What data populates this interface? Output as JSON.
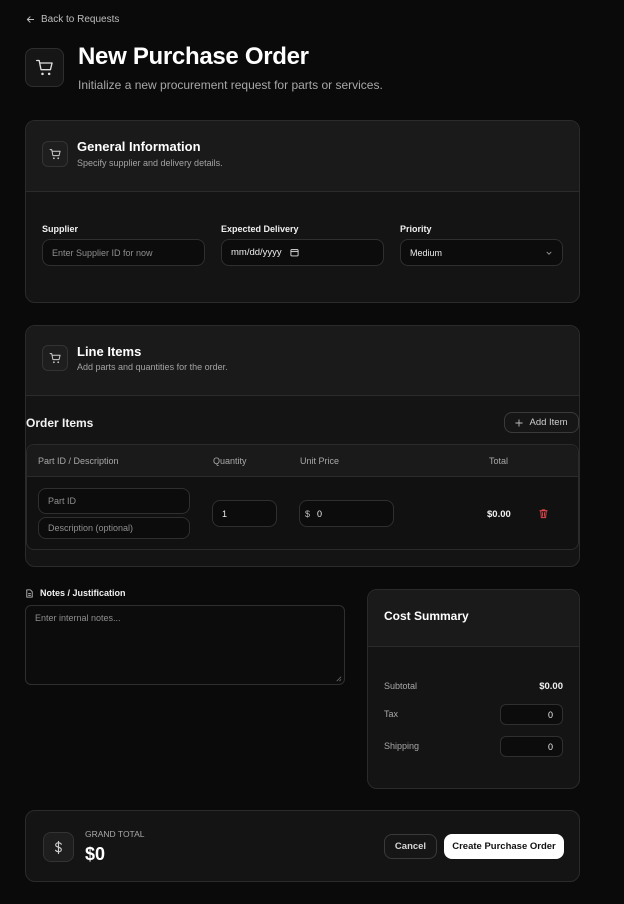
{
  "nav": {
    "back_label": "Back to Requests"
  },
  "header": {
    "title": "New Purchase Order",
    "subtitle": "Initialize a new procurement request for parts or services."
  },
  "general": {
    "title": "General Information",
    "subtitle": "Specify supplier and delivery details.",
    "supplier_label": "Supplier",
    "supplier_placeholder": "Enter Supplier ID for now",
    "delivery_label": "Expected Delivery",
    "delivery_value": "mm/dd/yyyy",
    "priority_label": "Priority",
    "priority_value": "Medium"
  },
  "line_items": {
    "title": "Line Items",
    "subtitle": "Add parts and quantities for the order.",
    "order_items_label": "Order Items",
    "add_item_label": "Add Item",
    "columns": [
      "Part ID / Description",
      "Quantity",
      "Unit Price",
      "Total"
    ],
    "rows": [
      {
        "part_placeholder": "Part ID",
        "desc_placeholder": "Description (optional)",
        "quantity": "1",
        "currency": "$",
        "unit_price": "0",
        "total": "$0.00"
      }
    ]
  },
  "notes": {
    "label": "Notes / Justification",
    "placeholder": "Enter internal notes..."
  },
  "summary": {
    "title": "Cost Summary",
    "subtotal_label": "Subtotal",
    "subtotal_value": "$0.00",
    "tax_label": "Tax",
    "tax_value": "0",
    "shipping_label": "Shipping",
    "shipping_value": "0"
  },
  "footer": {
    "grand_total_label": "GRAND TOTAL",
    "grand_total_value": "$0",
    "cancel_label": "Cancel",
    "create_label": "Create Purchase Order"
  },
  "colors": {
    "background": "#0a0a0a",
    "card": "#141414",
    "border": "#2b2b2b",
    "danger": "#e5484d",
    "primary_button": "#ffffff"
  },
  "icons": [
    "arrow-left-icon",
    "cart-icon",
    "plus-icon",
    "trash-icon",
    "chevron-down-icon",
    "calendar-icon",
    "document-icon",
    "dollar-icon"
  ]
}
